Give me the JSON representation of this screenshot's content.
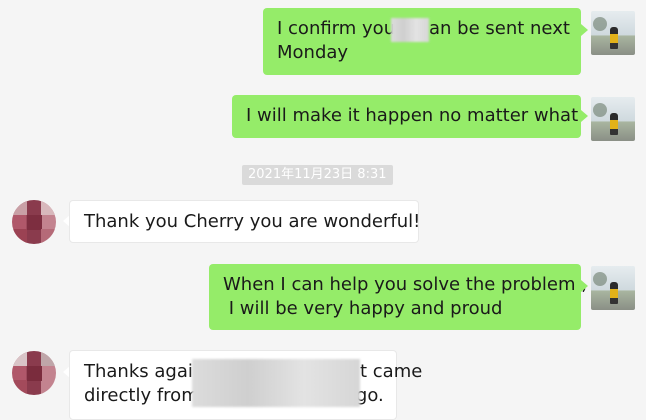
{
  "messages": [
    {
      "side": "out",
      "lines": [
        "I confirm you",
        "an be sent next",
        "Monday"
      ]
    },
    {
      "side": "out",
      "lines": [
        "I will make it happen no matter what"
      ]
    },
    {
      "side": "in",
      "lines": [
        "Thank you Cherry you are wonderful!"
      ]
    },
    {
      "side": "out",
      "lines": [
        "When I can help you solve the problem ,",
        " I will be very happy and proud"
      ]
    },
    {
      "side": "in",
      "lines": [
        "Thanks agair",
        "t came",
        "directly from",
        "Chicago."
      ]
    }
  ],
  "timestamp": "2021年11月23日 8:31",
  "colors": {
    "outgoing_bubble": "#95ec69",
    "incoming_bubble": "#ffffff",
    "background": "#f5f5f5"
  }
}
